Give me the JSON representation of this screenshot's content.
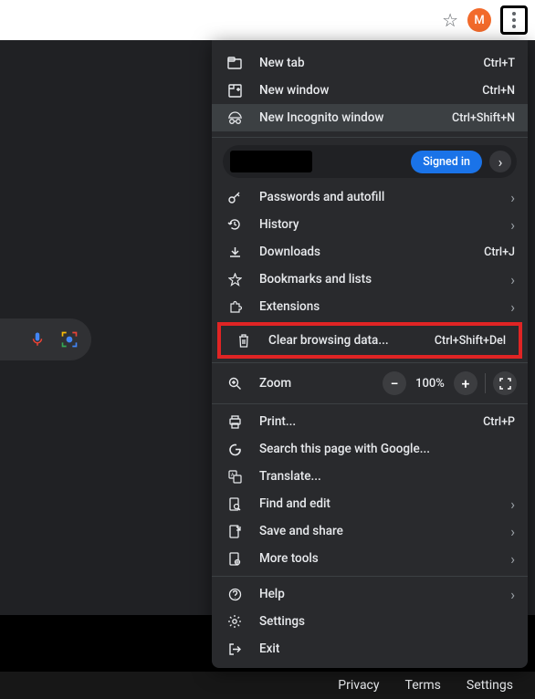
{
  "toolbar": {
    "avatar_letter": "M"
  },
  "account": {
    "signed_in_label": "Signed in"
  },
  "menu": {
    "new_tab": {
      "label": "New tab",
      "shortcut": "Ctrl+T"
    },
    "new_window": {
      "label": "New window",
      "shortcut": "Ctrl+N"
    },
    "incognito": {
      "label": "New Incognito window",
      "shortcut": "Ctrl+Shift+N"
    },
    "passwords": {
      "label": "Passwords and autofill"
    },
    "history": {
      "label": "History"
    },
    "downloads": {
      "label": "Downloads",
      "shortcut": "Ctrl+J"
    },
    "bookmarks": {
      "label": "Bookmarks and lists"
    },
    "extensions": {
      "label": "Extensions"
    },
    "clear": {
      "label": "Clear browsing data...",
      "shortcut": "Ctrl+Shift+Del"
    },
    "zoom": {
      "label": "Zoom",
      "value": "100%"
    },
    "print": {
      "label": "Print...",
      "shortcut": "Ctrl+P"
    },
    "search_google": {
      "label": "Search this page with Google..."
    },
    "translate": {
      "label": "Translate..."
    },
    "find": {
      "label": "Find and edit"
    },
    "save_share": {
      "label": "Save and share"
    },
    "more_tools": {
      "label": "More tools"
    },
    "help": {
      "label": "Help"
    },
    "settings": {
      "label": "Settings"
    },
    "exit": {
      "label": "Exit"
    }
  },
  "footer": {
    "privacy": "Privacy",
    "terms": "Terms",
    "settings": "Settings"
  }
}
